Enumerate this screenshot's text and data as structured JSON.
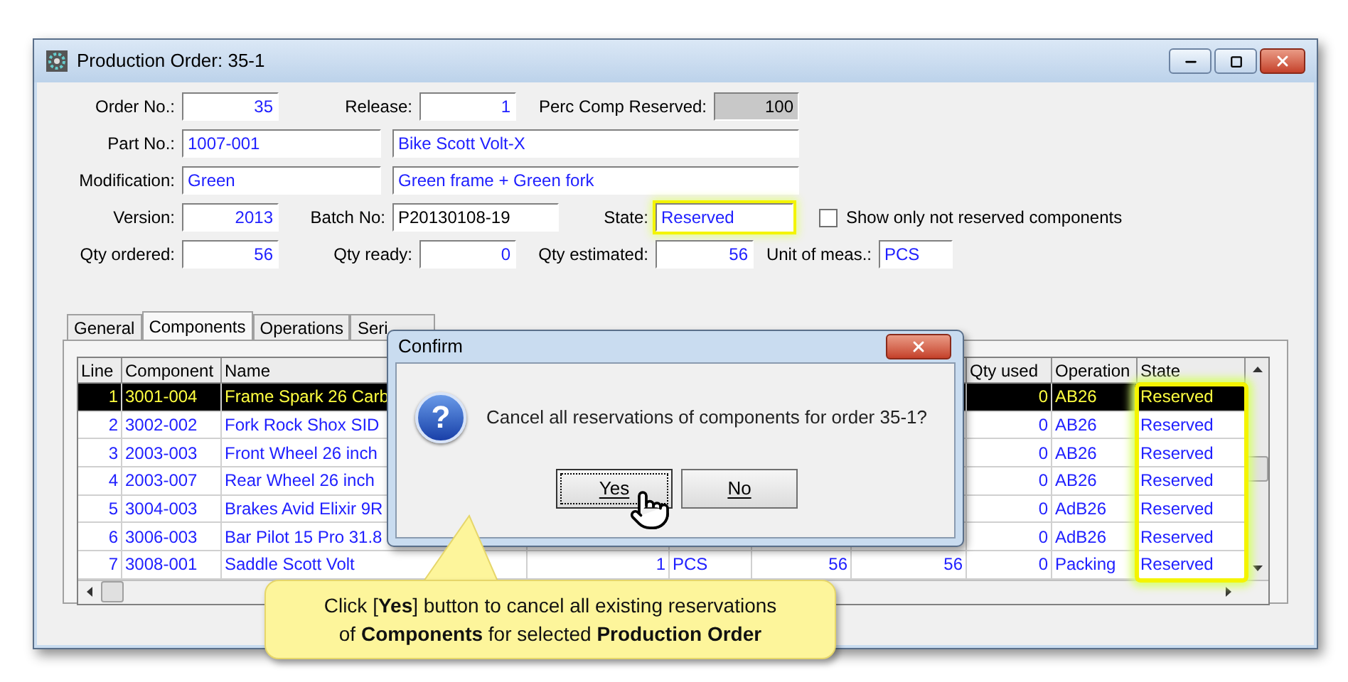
{
  "window": {
    "title": "Production Order: 35-1"
  },
  "form": {
    "rows": [
      [
        {
          "kind": "label",
          "text": "Order No.:"
        },
        {
          "kind": "field",
          "value": "35",
          "color": "#2020ff",
          "readonly": false,
          "highlighted": false
        },
        {
          "kind": "label",
          "text": "Release:"
        },
        {
          "kind": "field",
          "value": "1",
          "color": "#2020ff",
          "readonly": false,
          "highlighted": false
        },
        {
          "kind": "label",
          "text": "Perc Comp Reserved:"
        },
        {
          "kind": "field",
          "value": "100",
          "color": "#000000",
          "readonly": true,
          "highlighted": false
        }
      ],
      [
        {
          "kind": "label",
          "text": "Part No.:"
        },
        {
          "kind": "field",
          "value": "1007-001",
          "color": "#2020ff",
          "readonly": false,
          "highlighted": false
        },
        {
          "kind": "field",
          "value": "Bike Scott Volt-X",
          "color": "#2020ff",
          "readonly": false,
          "highlighted": false
        }
      ],
      [
        {
          "kind": "label",
          "text": "Modification:"
        },
        {
          "kind": "field",
          "value": "Green",
          "color": "#2020ff",
          "readonly": false,
          "highlighted": false
        },
        {
          "kind": "field",
          "value": "Green frame + Green fork",
          "color": "#2020ff",
          "readonly": false,
          "highlighted": false
        }
      ],
      [
        {
          "kind": "label",
          "text": "Version:"
        },
        {
          "kind": "field",
          "value": "2013",
          "color": "#2020ff",
          "readonly": false,
          "highlighted": false
        },
        {
          "kind": "label",
          "text": "Batch No:"
        },
        {
          "kind": "field",
          "value": "P20130108-19",
          "color": "#000000",
          "readonly": false,
          "highlighted": false
        },
        {
          "kind": "label",
          "text": "State:"
        },
        {
          "kind": "field",
          "value": "Reserved",
          "color": "#2020ff",
          "readonly": false,
          "highlighted": true
        },
        {
          "kind": "checkbox",
          "text": "Show only not reserved components",
          "checked": false
        }
      ],
      [
        {
          "kind": "label",
          "text": "Qty ordered:"
        },
        {
          "kind": "field",
          "value": "56",
          "color": "#2020ff",
          "readonly": false,
          "highlighted": false
        },
        {
          "kind": "label",
          "text": "Qty ready:"
        },
        {
          "kind": "field",
          "value": "0",
          "color": "#2020ff",
          "readonly": false,
          "highlighted": false
        },
        {
          "kind": "label",
          "text": "Qty estimated:"
        },
        {
          "kind": "field",
          "value": "56",
          "color": "#2020ff",
          "readonly": false,
          "highlighted": false
        },
        {
          "kind": "label",
          "text": "Unit of meas.:"
        },
        {
          "kind": "field",
          "value": "PCS",
          "color": "#2020ff",
          "readonly": false,
          "highlighted": false
        }
      ]
    ]
  },
  "tabs": [
    {
      "label": "General",
      "selected": false
    },
    {
      "label": "Components",
      "selected": true
    },
    {
      "label": "Operations",
      "selected": false
    },
    {
      "label": "Seri",
      "selected": false
    }
  ],
  "table": {
    "headers": {
      "line": "Line",
      "component": "Component",
      "name": "Name",
      "qty_used": "Qty used",
      "operation": "Operation",
      "state": "State"
    },
    "state_column_highlighted": true,
    "rows": [
      {
        "line": "1",
        "component": "3001-004",
        "name": "Frame Spark 26 Carb",
        "qty_used": "0",
        "operation": "AB26",
        "state": "Reserved",
        "selected": true
      },
      {
        "line": "2",
        "component": "3002-002",
        "name": "Fork Rock Shox SID",
        "qty_used": "0",
        "operation": "AB26",
        "state": "Reserved",
        "selected": false
      },
      {
        "line": "3",
        "component": "2003-003",
        "name": "Front Wheel 26 inch",
        "qty_used": "0",
        "operation": "AB26",
        "state": "Reserved",
        "selected": false
      },
      {
        "line": "4",
        "component": "2003-007",
        "name": "Rear Wheel 26 inch",
        "qty_used": "0",
        "operation": "AB26",
        "state": "Reserved",
        "selected": false
      },
      {
        "line": "5",
        "component": "3004-003",
        "name": "Brakes Avid Elixir 9R",
        "qty_used": "0",
        "operation": "AdB26",
        "state": "Reserved",
        "selected": false
      },
      {
        "line": "6",
        "component": "3006-003",
        "name": "Bar Pilot 15 Pro 31.8",
        "qty_used": "0",
        "operation": "AdB26",
        "state": "Reserved",
        "selected": false
      },
      {
        "line": "7",
        "component": "3008-001",
        "name": "Saddle Scott Volt",
        "column_4": "1",
        "column_5": "PCS",
        "column_6": "56",
        "column_7": "56",
        "qty_used": "0",
        "operation": "Packing",
        "state": "Reserved",
        "selected": false
      }
    ]
  },
  "dialog": {
    "title": "Confirm",
    "icon": "?",
    "message": "Cancel all reservations of components for order 35-1?",
    "buttons": [
      {
        "label": "Yes",
        "focused": true
      },
      {
        "label": "No",
        "focused": false
      }
    ]
  },
  "callout": {
    "lines": [
      "Click [**Yes**] button to cancel all existing reservations",
      "of **Components** for selected **Production Order**"
    ]
  }
}
